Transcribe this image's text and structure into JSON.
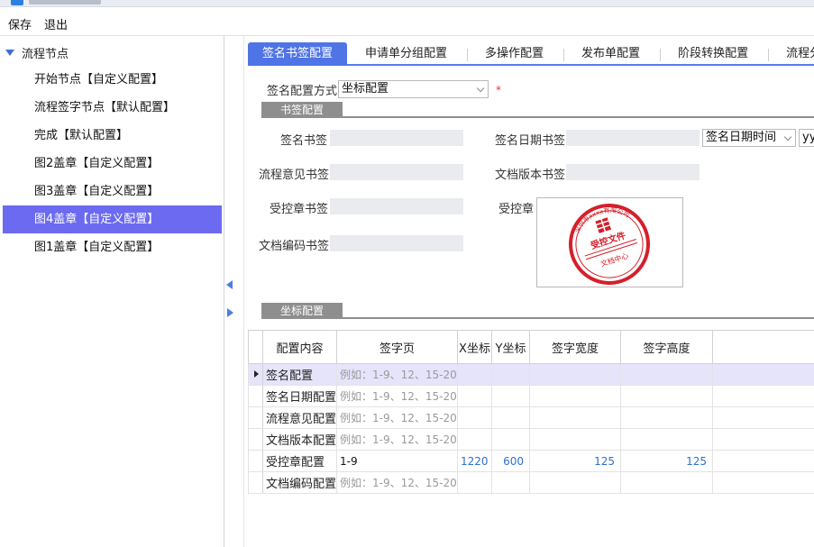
{
  "menu": {
    "save": "保存",
    "exit": "退出"
  },
  "tree": {
    "root": "流程节点",
    "items": [
      "开始节点【自定义配置】",
      "流程签字节点【默认配置】",
      "完成【默认配置】",
      "图2盖章【自定义配置】",
      "图3盖章【自定义配置】",
      "图4盖章【自定义配置】",
      "图1盖章【自定义配置】"
    ],
    "selected_index": 5
  },
  "tabs": [
    "签名书签配置",
    "申请单分组配置",
    "多操作配置",
    "发布单配置",
    "阶段转换配置",
    "流程分组"
  ],
  "form": {
    "mode_label": "签名配置方式",
    "mode_value": "坐标配置",
    "required_mark": "*",
    "section_bookmark": "书签配置",
    "sign_bookmark": "签名书签",
    "sign_date_bookmark": "签名日期书签",
    "date_type_value": "签名日期时间",
    "date_format_value": "yyy",
    "flow_opinion_bookmark": "流程意见书签",
    "doc_version_bookmark": "文档版本书签",
    "controlled_bookmark": "受控章书签",
    "controlled_stamp": "受控章",
    "doc_code_bookmark": "文档编码书签",
    "section_coord": "坐标配置"
  },
  "stamp": {
    "top_text": "深圳市xxxx有限公司",
    "center_title": "受控文件",
    "bottom_text": "文档中心",
    "color": "#d4202a"
  },
  "grid": {
    "columns": [
      "配置内容",
      "签字页",
      "X坐标",
      "Y坐标",
      "签字宽度",
      "签字高度"
    ],
    "placeholder": "例如：1-9、12、15-20",
    "rows": [
      {
        "name": "签名配置",
        "page": "",
        "x": "",
        "y": "",
        "w": "",
        "h": ""
      },
      {
        "name": "签名日期配置",
        "page": "",
        "x": "",
        "y": "",
        "w": "",
        "h": ""
      },
      {
        "name": "流程意见配置",
        "page": "",
        "x": "",
        "y": "",
        "w": "",
        "h": ""
      },
      {
        "name": "文档版本配置",
        "page": "",
        "x": "",
        "y": "",
        "w": "",
        "h": ""
      },
      {
        "name": "受控章配置",
        "page": "1-9",
        "x": "1220",
        "y": "600",
        "w": "125",
        "h": "125"
      },
      {
        "name": "文档编码配置",
        "page": "",
        "x": "",
        "y": "",
        "w": "",
        "h": ""
      }
    ]
  }
}
